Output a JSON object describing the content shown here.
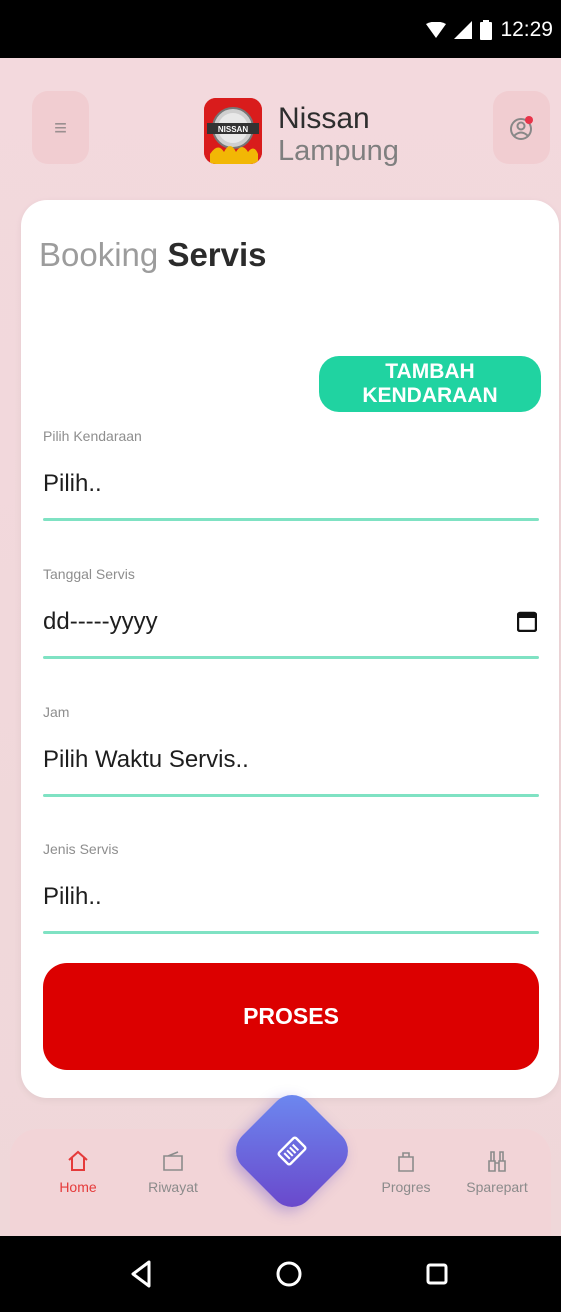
{
  "status_bar": {
    "time": "12:29"
  },
  "header": {
    "brand_name": "Nissan",
    "brand_city": "Lampung",
    "logo_text": "NISSAN"
  },
  "booking": {
    "title_light": "Booking ",
    "title_bold": "Servis",
    "add_vehicle_label": "TAMBAH KENDARAAN",
    "fields": [
      {
        "label": "Pilih Kendaraan",
        "value": "Pilih.."
      },
      {
        "label": "Tanggal Servis",
        "value": "dd-----yyyy"
      },
      {
        "label": "Jam",
        "value": "Pilih Waktu Servis.."
      },
      {
        "label": "Jenis Servis",
        "value": "Pilih.."
      }
    ],
    "submit_label": "PROSES"
  },
  "tabs": [
    {
      "label": "Home",
      "icon": "home-icon",
      "active": true
    },
    {
      "label": "Riwayat",
      "icon": "wallet-icon",
      "active": false
    },
    {
      "label": "Progres",
      "icon": "bag-icon",
      "active": false
    },
    {
      "label": "Sparepart",
      "icon": "binoculars-icon",
      "active": false
    }
  ],
  "colors": {
    "accent_red": "#dc0000",
    "accent_green": "#20d3a1",
    "field_line": "#7fe2c3",
    "background_pink": "#f3d9dd"
  }
}
